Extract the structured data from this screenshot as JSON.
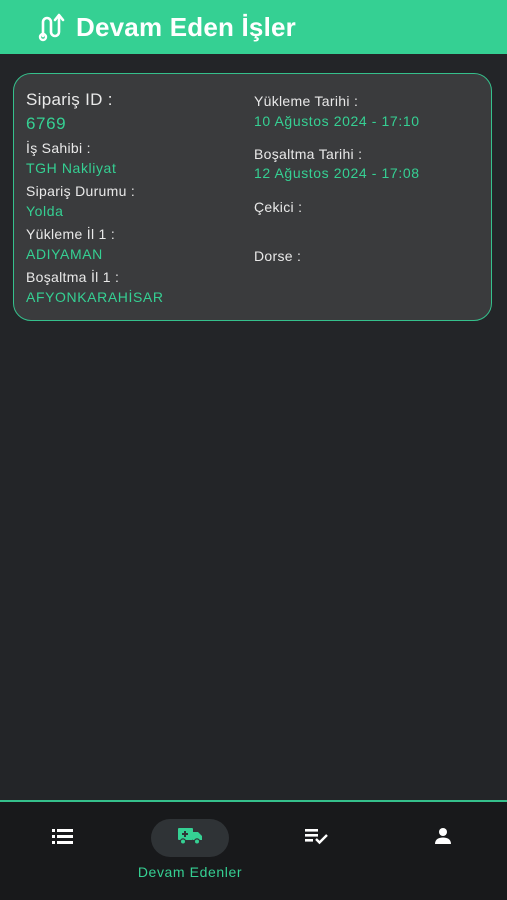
{
  "header": {
    "title": "Devam Eden İşler",
    "icon": "route-icon"
  },
  "order": {
    "id_label": "Sipariş ID :",
    "id_value": "6769",
    "owner_label": "İş Sahibi :",
    "owner_value": "TGH Nakliyat",
    "status_label": "Sipariş Durumu :",
    "status_value": "Yolda",
    "load_city_label": "Yükleme İl 1 :",
    "load_city_value": "ADIYAMAN",
    "unload_city_label": "Boşaltma İl 1 :",
    "unload_city_value": "AFYONKARAHİSAR",
    "load_date_label": "Yükleme Tarihi :",
    "load_date_value": "10 Ağustos 2024 - 17:10",
    "unload_date_label": "Boşaltma Tarihi :",
    "unload_date_value": "12 Ağustos 2024 - 17:08",
    "tractor_label": "Çekici :",
    "trailer_label": "Dorse :"
  },
  "bottom_nav": {
    "active_label": "Devam Edenler",
    "items": [
      {
        "icon": "list-icon"
      },
      {
        "icon": "truck-icon"
      },
      {
        "icon": "checklist-icon"
      },
      {
        "icon": "person-icon"
      }
    ]
  },
  "colors": {
    "accent": "#35d093",
    "background": "#232528",
    "card": "#3a3b3d",
    "nav_background": "#18191b"
  }
}
